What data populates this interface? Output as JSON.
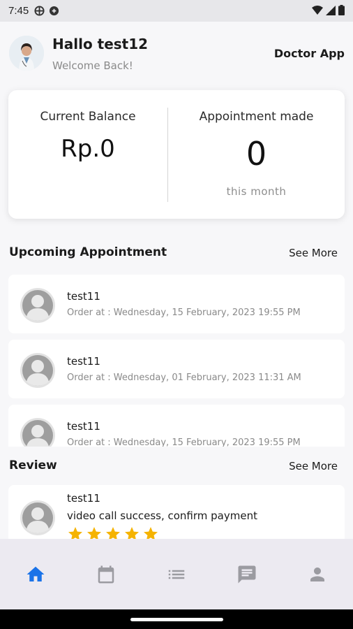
{
  "status_bar": {
    "time": "7:45"
  },
  "header": {
    "greeting": "Hallo test12",
    "subtitle": "Welcome Back!",
    "app_name": "Doctor App"
  },
  "summary": {
    "balance_label": "Current Balance",
    "balance_value": "Rp.0",
    "appointment_label": "Appointment made",
    "appointment_value": "0",
    "appointment_sub": "this month"
  },
  "upcoming": {
    "title": "Upcoming Appointment",
    "see_more": "See More",
    "items": [
      {
        "name": "test11",
        "order": "Order at : Wednesday, 15 February, 2023 19:55 PM"
      },
      {
        "name": "test11",
        "order": "Order at : Wednesday, 01 February, 2023 11:31 AM"
      },
      {
        "name": "test11",
        "order": "Order at : Wednesday, 15 February, 2023 19:55 PM"
      }
    ]
  },
  "review": {
    "title": "Review",
    "see_more": "See More",
    "items": [
      {
        "name": "test11",
        "text": "video call success, confirm payment",
        "rating": 5
      }
    ]
  },
  "bottom_nav": {
    "active": "home",
    "items": [
      "home-icon",
      "calendar-icon",
      "list-icon",
      "chat-icon",
      "person-icon"
    ]
  },
  "colors": {
    "accent": "#1a73e8",
    "star": "#f5b301",
    "nav_icon": "#9b9ba1"
  }
}
